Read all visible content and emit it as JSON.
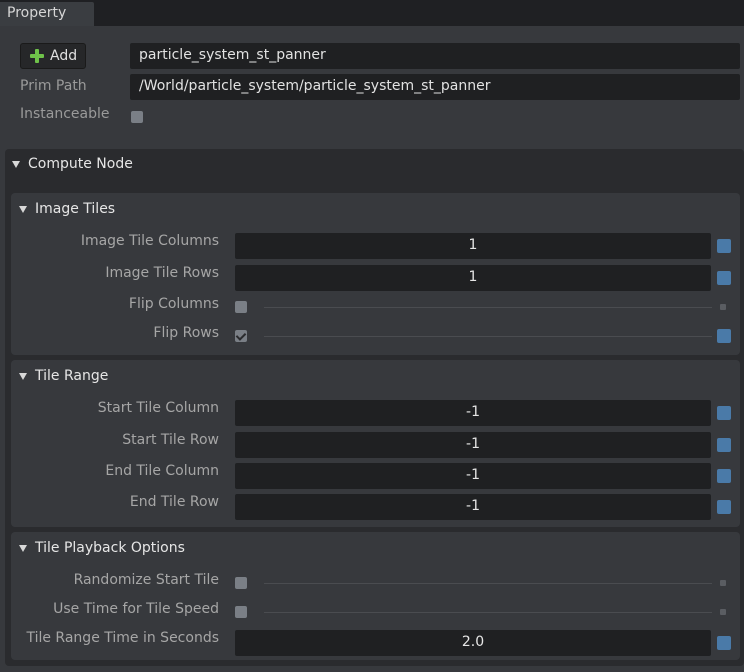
{
  "tabbar": {
    "tab_label": "Property"
  },
  "header": {
    "add_label": "Add",
    "name_value": "particle_system_st_panner",
    "prim_path_label": "Prim Path",
    "prim_path_value": "/World/particle_system/particle_system_st_panner",
    "instanceable_label": "Instanceable",
    "instanceable_checked": false
  },
  "compute_node": {
    "title": "Compute Node",
    "image_tiles": {
      "title": "Image Tiles",
      "image_tile_columns_label": "Image Tile Columns",
      "image_tile_columns_value": "1",
      "image_tile_rows_label": "Image Tile Rows",
      "image_tile_rows_value": "1",
      "flip_columns_label": "Flip Columns",
      "flip_columns_checked": false,
      "flip_rows_label": "Flip Rows",
      "flip_rows_checked": true
    },
    "tile_range": {
      "title": "Tile Range",
      "start_tile_column_label": "Start Tile Column",
      "start_tile_column_value": "-1",
      "start_tile_row_label": "Start Tile Row",
      "start_tile_row_value": "-1",
      "end_tile_column_label": "End Tile Column",
      "end_tile_column_value": "-1",
      "end_tile_row_label": "End Tile Row",
      "end_tile_row_value": "-1"
    },
    "tile_playback": {
      "title": "Tile Playback Options",
      "randomize_start_tile_label": "Randomize Start Tile",
      "randomize_start_tile_checked": false,
      "use_time_for_tile_speed_label": "Use Time for Tile Speed",
      "use_time_for_tile_speed_checked": false,
      "tile_range_time_label": "Tile Range Time in Seconds",
      "tile_range_time_value": "2.0"
    }
  },
  "colors": {
    "panel": "#37393d",
    "frame": "#2a2b2e",
    "field": "#1f2022",
    "accent_blue": "#4a7aa8",
    "add_green": "#6fc24a"
  }
}
